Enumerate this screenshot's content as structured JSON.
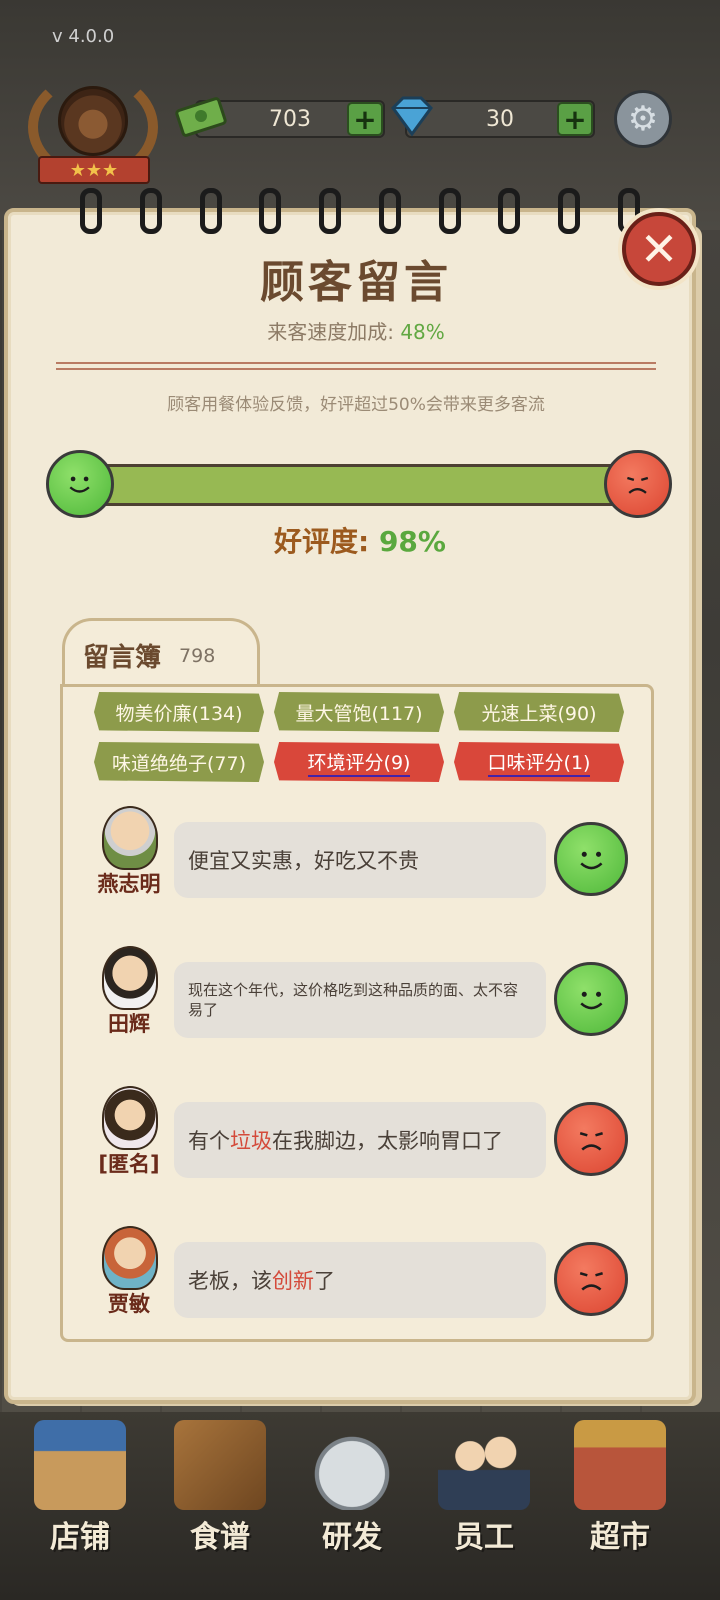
{
  "version": "v 4.0.0",
  "currency": {
    "money": "703",
    "gems": "30",
    "money_icon": "cash-icon",
    "gem_icon": "diamond-icon",
    "plus": "+"
  },
  "badge": {
    "stars": "★★★"
  },
  "panel": {
    "title": "顾客留言",
    "speed_label": "来客速度加成:",
    "speed_value": "48%",
    "hint": "顾客用餐体验反馈，好评超过50%会带来更多客流",
    "rating_label": "好评度:",
    "rating_value": "98%",
    "rating_fraction": 0.98,
    "close": "✕"
  },
  "guestbook": {
    "label": "留言簿",
    "count": "798",
    "tags": [
      {
        "text": "物美价廉(134)",
        "type": "good"
      },
      {
        "text": "量大管饱(117)",
        "type": "good"
      },
      {
        "text": "光速上菜(90)",
        "type": "good"
      },
      {
        "text": "味道绝绝子(77)",
        "type": "good"
      },
      {
        "text": "环境评分(9)",
        "type": "bad"
      },
      {
        "text": "口味评分(1)",
        "type": "bad"
      }
    ],
    "messages": [
      {
        "name": "燕志明",
        "text": "便宜又实惠，好吃又不贵",
        "sentiment": "good"
      },
      {
        "name": "田辉",
        "text": "现在这个年代，这价格吃到这种品质的面、太不容易了",
        "sentiment": "good"
      },
      {
        "name": "[匿名]",
        "text_pre": "有个",
        "text_hl": "垃圾",
        "text_post": "在我脚边，太影响胃口了",
        "sentiment": "bad"
      },
      {
        "name": "贾敏",
        "text_pre": "老板，该",
        "text_hl": "创新",
        "text_post": "了",
        "sentiment": "bad"
      }
    ]
  },
  "nav": [
    {
      "label": "店铺",
      "icon": "shop-icon"
    },
    {
      "label": "食谱",
      "icon": "recipe-book-icon"
    },
    {
      "label": "研发",
      "icon": "cooking-pot-icon"
    },
    {
      "label": "员工",
      "icon": "staff-icon"
    },
    {
      "label": "超市",
      "icon": "supermarket-icon"
    }
  ],
  "colors": {
    "good": "#5aa83e",
    "bad": "#d9473a",
    "paper": "#f2ead7",
    "title": "#6b4a2f"
  }
}
